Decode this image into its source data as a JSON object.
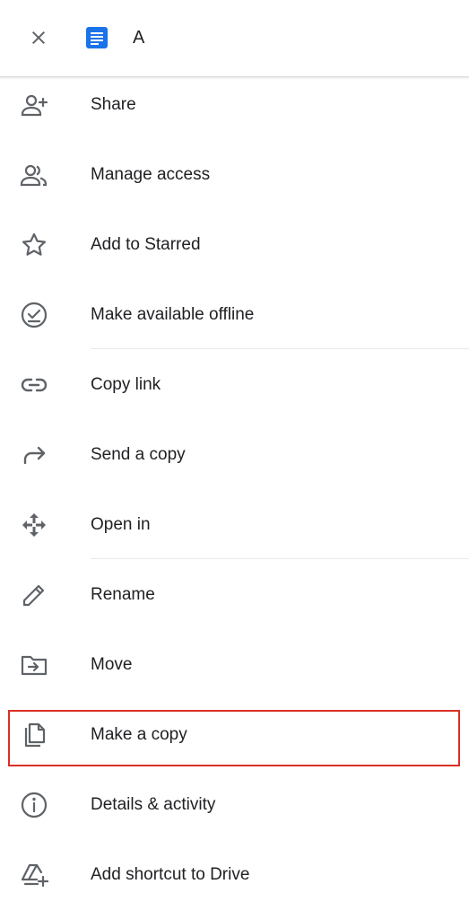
{
  "header": {
    "title": "A",
    "close_icon": "close-icon",
    "doc_icon": "google-docs-icon",
    "doc_color": "#1a73e8"
  },
  "menu": {
    "items": [
      {
        "label": "Share",
        "icon": "person-add-icon"
      },
      {
        "label": "Manage access",
        "icon": "people-icon"
      },
      {
        "label": "Add to Starred",
        "icon": "star-outline-icon"
      },
      {
        "label": "Make available offline",
        "icon": "offline-pin-icon"
      },
      {
        "label": "Copy link",
        "icon": "link-icon"
      },
      {
        "label": "Send a copy",
        "icon": "forward-arrow-icon"
      },
      {
        "label": "Open in",
        "icon": "open-with-arrows-icon"
      },
      {
        "label": "Rename",
        "icon": "pencil-icon"
      },
      {
        "label": "Move",
        "icon": "folder-move-icon"
      },
      {
        "label": "Make a copy",
        "icon": "file-copy-icon"
      },
      {
        "label": "Details & activity",
        "icon": "info-icon"
      },
      {
        "label": "Add shortcut to Drive",
        "icon": "drive-add-shortcut-icon"
      }
    ]
  },
  "colors": {
    "icon": "#5f6368",
    "text": "#202124",
    "highlight_border": "#d93025",
    "divider": "#e8eaed"
  }
}
